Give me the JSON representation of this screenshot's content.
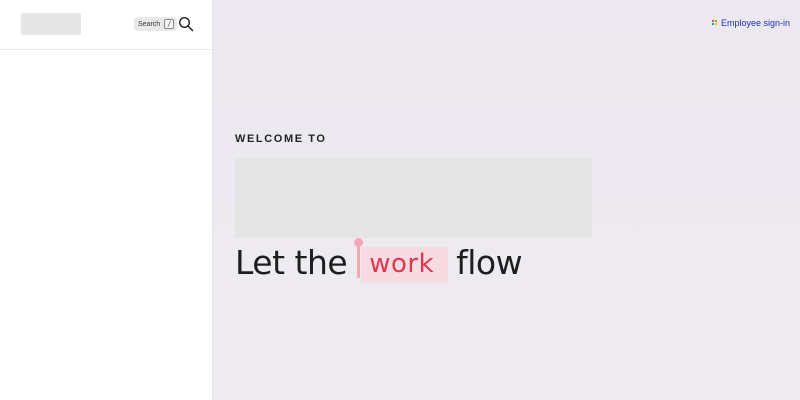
{
  "sidebar": {
    "search": {
      "label": "Search",
      "shortcut": "/"
    }
  },
  "header": {
    "signin_label": "Employee sign-in",
    "signin_icon": "grid-icon"
  },
  "hero": {
    "welcome": "WELCOME TO",
    "headline_prefix": "Let the",
    "headline_highlight": "work",
    "headline_suffix": "flow"
  },
  "colors": {
    "accent_link": "#1f2fb3",
    "highlight_text": "#e0394f",
    "highlight_bg": "#f6dbe2",
    "cursor": "#f4a6b5"
  }
}
